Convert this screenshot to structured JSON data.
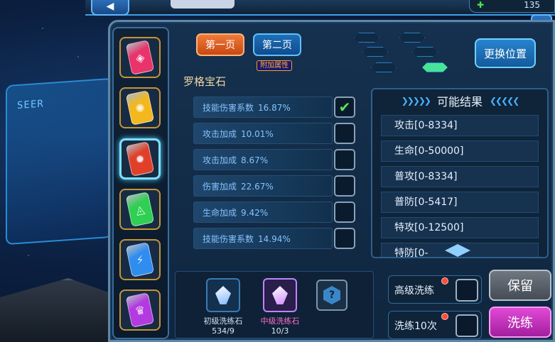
{
  "header": {
    "back_icon": "back-arrow-icon",
    "energy_icon": "energy-plus-icon",
    "energy_value": "135",
    "info_icon": "info-icon",
    "info_symbol": "!"
  },
  "background": {
    "panel_text": "SEER"
  },
  "tabs": [
    {
      "label": "第一页",
      "active": true
    },
    {
      "label": "第二页",
      "active": false
    }
  ],
  "tab2_badge": "附加属性",
  "swap_button": "更换位置",
  "gem_name": "罗格宝石",
  "gems": [
    {
      "name": "gem-red-pink",
      "color": "#e8336b",
      "glyph": "◈"
    },
    {
      "name": "gem-yellow",
      "color": "#f2b81e",
      "glyph": "✺"
    },
    {
      "name": "gem-red",
      "color": "#e0402a",
      "glyph": "✹"
    },
    {
      "name": "gem-green",
      "color": "#2ecf52",
      "glyph": "◬"
    },
    {
      "name": "gem-blue",
      "color": "#2f8df0",
      "glyph": "⚡"
    },
    {
      "name": "gem-purple",
      "color": "#b23ae0",
      "glyph": "♛"
    }
  ],
  "attributes": [
    {
      "label": "技能伤害系数",
      "value": "16.87%",
      "checked": true
    },
    {
      "label": "攻击加成",
      "value": "10.01%",
      "checked": false
    },
    {
      "label": "攻击加成",
      "value": "8.67%",
      "checked": false
    },
    {
      "label": "伤害加成",
      "value": "22.67%",
      "checked": false
    },
    {
      "label": "生命加成",
      "value": "9.42%",
      "checked": false
    },
    {
      "label": "技能伤害系数",
      "value": "14.94%",
      "checked": false
    }
  ],
  "check_symbol": "✔",
  "results": {
    "title": "可能结果",
    "chevrons_left": "❯❯❯❯❯",
    "chevrons_right": "❮❮❮❮❮",
    "items": [
      "攻击[0-8334]",
      "生命[0-50000]",
      "普攻[0-8334]",
      "普防[0-5417]",
      "特攻[0-12500]",
      "特防[0-"
    ]
  },
  "stones": [
    {
      "label": "初级洗练石",
      "count": "534/9",
      "color": "#7fb8ff",
      "label_color": "#cfe2f5"
    },
    {
      "label": "中级洗练石",
      "count": "10/3",
      "color": "#d28cff",
      "label_color": "#ff6fcf"
    }
  ],
  "unknown_slot_symbol": "?",
  "wash_options": [
    {
      "label": "高级洗练"
    },
    {
      "label": "洗练10次"
    }
  ],
  "keep_button": "保留",
  "wash_button": "洗练"
}
